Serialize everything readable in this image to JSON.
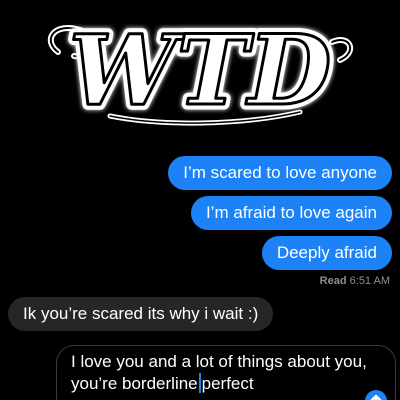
{
  "logo": {
    "text": "WTD"
  },
  "messages": [
    {
      "direction": "sent",
      "text": "I’m scared to love anyone"
    },
    {
      "direction": "sent",
      "text": "I’m afraid to love again"
    },
    {
      "direction": "sent",
      "text": "Deeply afraid"
    },
    {
      "direction": "received",
      "text": "Ik you’re scared its why i wait :)"
    }
  ],
  "read_receipt": {
    "label": "Read",
    "time": "6:51 AM"
  },
  "compose": {
    "text_before_cursor": "I love you and a lot of things about you, you’re borderline",
    "text_after_cursor": "perfect"
  },
  "colors": {
    "sent_bubble": "#1d82f5",
    "received_bubble": "#262628",
    "background": "#000000"
  },
  "icons": {
    "send": "send-arrow-icon"
  }
}
